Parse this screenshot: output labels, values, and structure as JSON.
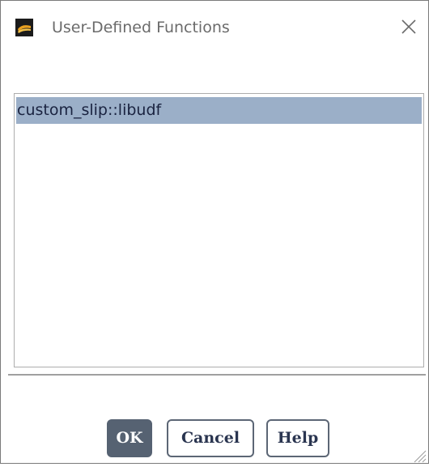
{
  "window": {
    "title": "User-Defined Functions",
    "app_icon": "ansys-fluent-icon",
    "close_icon": "close-icon"
  },
  "list": {
    "items": [
      {
        "label": "custom_slip::libudf",
        "selected": true
      }
    ]
  },
  "buttons": {
    "ok_label": "OK",
    "cancel_label": "Cancel",
    "help_label": "Help"
  },
  "colors": {
    "selection": "#9bafc8",
    "ok_button": "#566272",
    "button_border": "#5c6675",
    "title_text": "#6b6b6b"
  }
}
